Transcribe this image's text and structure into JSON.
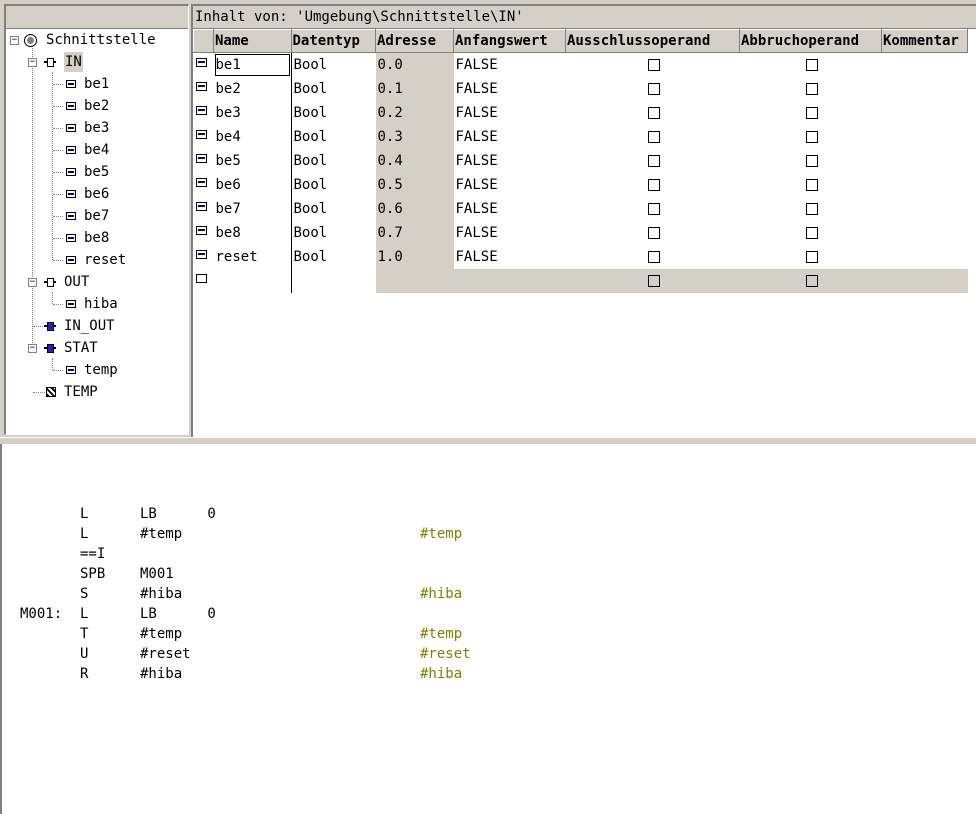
{
  "table_title": "Inhalt von: 'Umgebung\\Schnittstelle\\IN'",
  "tree": {
    "root": "Schnittstelle",
    "in": "IN",
    "in_children": [
      "be1",
      "be2",
      "be3",
      "be4",
      "be5",
      "be6",
      "be7",
      "be8",
      "reset"
    ],
    "out": "OUT",
    "out_children": [
      "hiba"
    ],
    "in_out": "IN_OUT",
    "stat": "STAT",
    "stat_children": [
      "temp"
    ],
    "temp": "TEMP"
  },
  "columns": [
    "Name",
    "Datentyp",
    "Adresse",
    "Anfangswert",
    "Ausschlussoperand",
    "Abbruchoperand",
    "Kommentar"
  ],
  "rows": [
    {
      "name": "be1",
      "type": "Bool",
      "addr": "0.0",
      "init": "FALSE"
    },
    {
      "name": "be2",
      "type": "Bool",
      "addr": "0.1",
      "init": "FALSE"
    },
    {
      "name": "be3",
      "type": "Bool",
      "addr": "0.2",
      "init": "FALSE"
    },
    {
      "name": "be4",
      "type": "Bool",
      "addr": "0.3",
      "init": "FALSE"
    },
    {
      "name": "be5",
      "type": "Bool",
      "addr": "0.4",
      "init": "FALSE"
    },
    {
      "name": "be6",
      "type": "Bool",
      "addr": "0.5",
      "init": "FALSE"
    },
    {
      "name": "be7",
      "type": "Bool",
      "addr": "0.6",
      "init": "FALSE"
    },
    {
      "name": "be8",
      "type": "Bool",
      "addr": "0.7",
      "init": "FALSE"
    },
    {
      "name": "reset",
      "type": "Bool",
      "addr": "1.0",
      "init": "FALSE"
    }
  ],
  "code": [
    {
      "label": "",
      "op": "L",
      "arg": "LB      0",
      "comment": ""
    },
    {
      "label": "",
      "op": "L",
      "arg": "#temp",
      "comment": "#temp"
    },
    {
      "label": "",
      "op": "==I",
      "arg": "",
      "comment": ""
    },
    {
      "label": "",
      "op": "SPB",
      "arg": "M001",
      "comment": ""
    },
    {
      "label": "",
      "op": "S",
      "arg": "#hiba",
      "comment": "#hiba"
    },
    {
      "label": "M001:",
      "op": "L",
      "arg": "LB      0",
      "comment": ""
    },
    {
      "label": "",
      "op": "T",
      "arg": "#temp",
      "comment": "#temp"
    },
    {
      "label": "",
      "op": "U",
      "arg": "#reset",
      "comment": "#reset"
    },
    {
      "label": "",
      "op": "R",
      "arg": "#hiba",
      "comment": "#hiba"
    }
  ],
  "colors": {
    "panel": "#d4d0c8",
    "comment": "#808000"
  }
}
